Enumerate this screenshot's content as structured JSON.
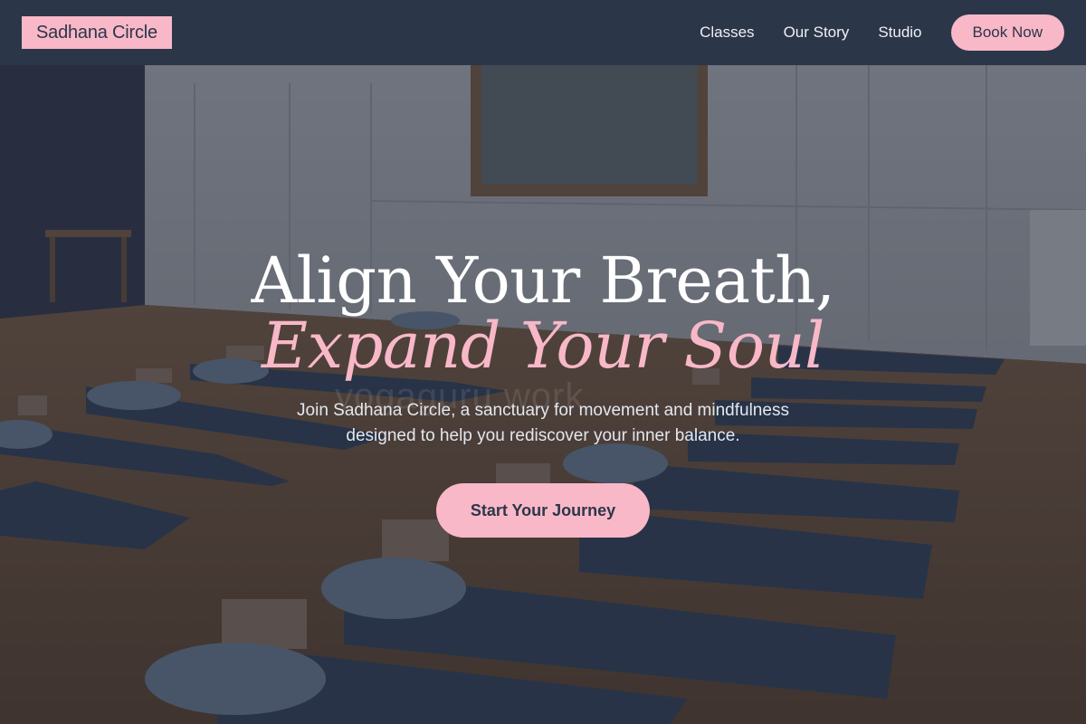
{
  "header": {
    "logo": "Sadhana Circle",
    "nav": [
      {
        "label": "Classes"
      },
      {
        "label": "Our Story"
      },
      {
        "label": "Studio"
      }
    ],
    "book_label": "Book Now"
  },
  "hero": {
    "headline_line1": "Align Your Breath,",
    "headline_line2": "Expand Your Soul",
    "subtitle_line1": "Join Sadhana Circle, a sanctuary for movement and mindfulness",
    "subtitle_line2": "designed to help you rediscover your inner balance.",
    "cta_label": "Start Your Journey",
    "watermark": "yogaguru work"
  },
  "colors": {
    "header_bg": "#2c3649",
    "accent_pink": "#f8b8c8",
    "text_light": "#eef1f5"
  }
}
